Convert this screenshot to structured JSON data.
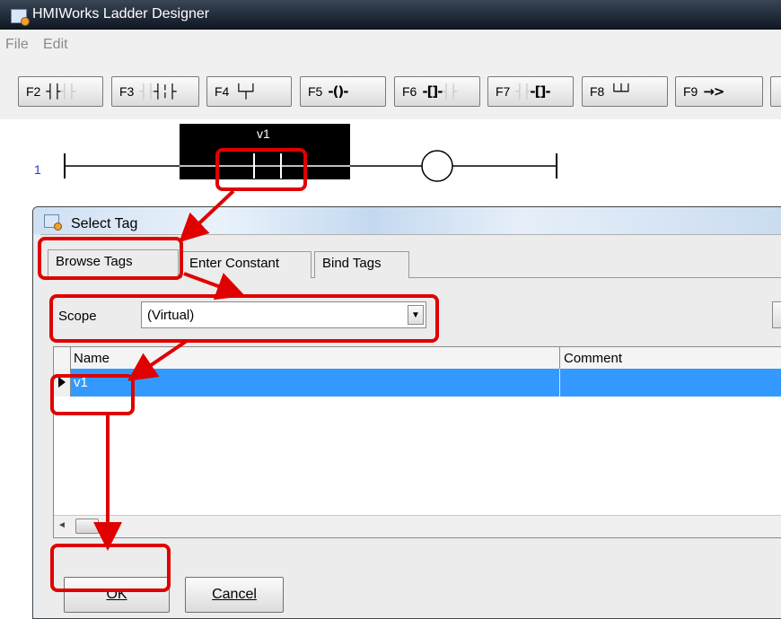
{
  "window": {
    "title": "HMIWorks Ladder Designer",
    "icon": "app-icon"
  },
  "menu": [
    {
      "label": "File"
    },
    {
      "label": "Edit"
    }
  ],
  "toolbar": {
    "buttons": [
      {
        "key": "F2",
        "icon": "normally-open-contact-icon"
      },
      {
        "key": "F3",
        "icon": "normally-closed-contact-icon"
      },
      {
        "key": "F4",
        "icon": "parallel-branch-icon"
      },
      {
        "key": "F5",
        "icon": "coil-icon"
      },
      {
        "key": "F6",
        "icon": "set-coil-icon"
      },
      {
        "key": "F7",
        "icon": "reset-coil-icon"
      },
      {
        "key": "F8",
        "icon": "branch-icon"
      },
      {
        "key": "F9",
        "icon": "jump-icon"
      }
    ]
  },
  "ladder": {
    "rung_number": "1",
    "contact_tag": "v1"
  },
  "dialog": {
    "title": "Select Tag",
    "tabs": [
      {
        "label": "Browse Tags",
        "active": true
      },
      {
        "label": "Enter Constant",
        "active": false
      },
      {
        "label": "Bind Tags",
        "active": false
      }
    ],
    "scope": {
      "label": "Scope",
      "value": "(Virtual)"
    },
    "grid": {
      "columns": [
        "Name",
        "Comment"
      ],
      "rows": [
        {
          "name": "v1",
          "comment": "",
          "selected": true
        }
      ]
    },
    "ok_label": "OK",
    "cancel_label": "Cancel"
  },
  "colors": {
    "selection": "#3399ff",
    "annotation": "#e00000",
    "rung_number": "#1e3cc8"
  }
}
